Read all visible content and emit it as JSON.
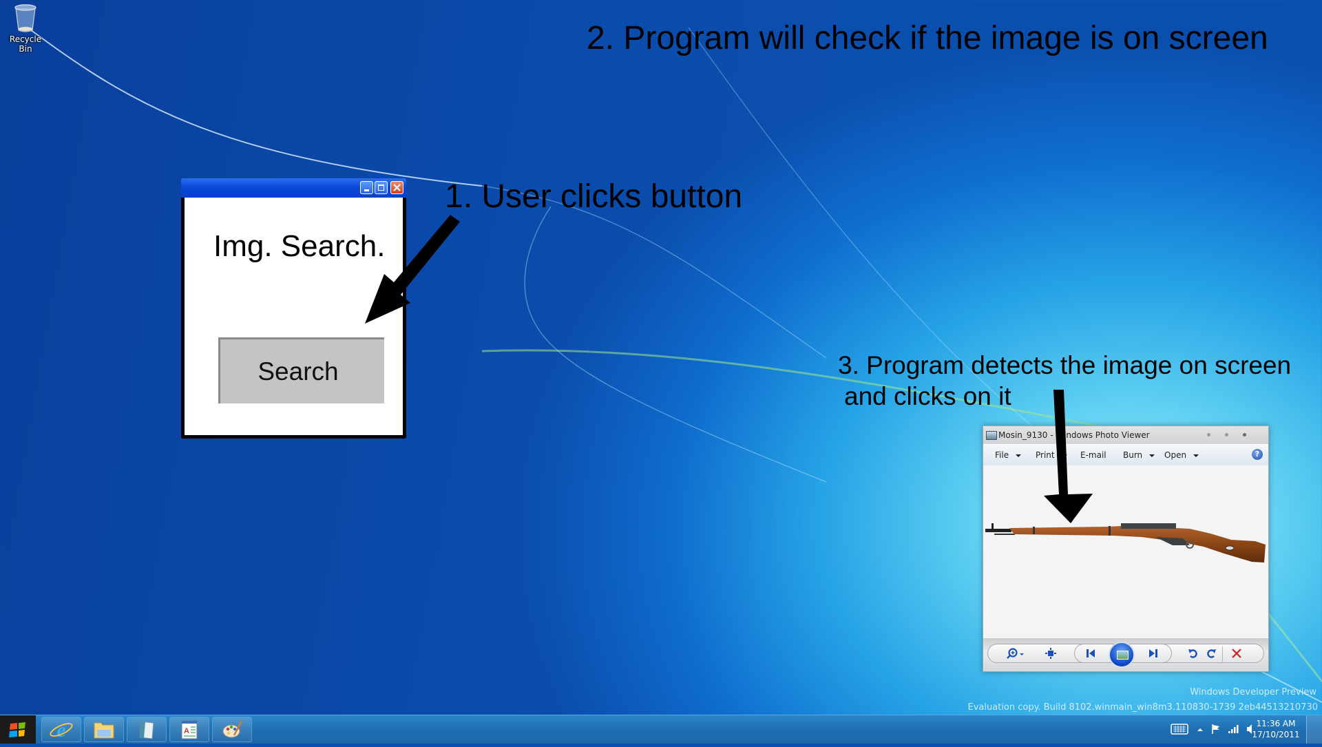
{
  "desktop": {
    "icons": [
      {
        "label": "Recycle Bin",
        "icon": "recycle-bin-icon"
      }
    ],
    "watermark": {
      "line1": "Windows Developer Preview",
      "line2": "Evaluation copy. Build 8102.winmain_win8m3.110830-1739 2eb44513210730"
    }
  },
  "annotations": {
    "step1": "1. User clicks button",
    "step2": "2. Program will check if the image is on screen",
    "step3_line1": "3. Program detects the image on screen",
    "step3_line2": "and clicks on it"
  },
  "img_search_window": {
    "title_buttons": [
      "minimize",
      "maximize",
      "close"
    ],
    "app_title": "Img. Search.",
    "search_button_label": "Search",
    "colors": {
      "titlebar": "#0a48d8",
      "button_bg": "#c4c4c4"
    }
  },
  "photo_viewer": {
    "title": "Mosin_9130 - Windows Photo Viewer",
    "menu": [
      {
        "label": "File",
        "has_dropdown": true
      },
      {
        "label": "Print",
        "has_dropdown": true
      },
      {
        "label": "E-mail",
        "has_dropdown": false
      },
      {
        "label": "Burn",
        "has_dropdown": true
      },
      {
        "label": "Open",
        "has_dropdown": true
      }
    ],
    "help_label": "?",
    "image_subject": "Mosin-Nagant rifle",
    "controls": [
      "zoom",
      "actual-size",
      "previous",
      "slideshow",
      "next",
      "rotate-counterclockwise",
      "rotate-clockwise",
      "delete"
    ]
  },
  "taskbar": {
    "pinned": [
      {
        "name": "Internet Explorer",
        "icon": "internet-explorer-icon"
      },
      {
        "name": "File Explorer",
        "icon": "file-explorer-icon"
      },
      {
        "name": "Notepad",
        "icon": "notepad-icon"
      },
      {
        "name": "WordPad",
        "icon": "wordpad-icon"
      },
      {
        "name": "Paint",
        "icon": "paint-icon"
      }
    ],
    "clock": {
      "time": "11:36 AM",
      "date": "17/10/2011"
    }
  }
}
